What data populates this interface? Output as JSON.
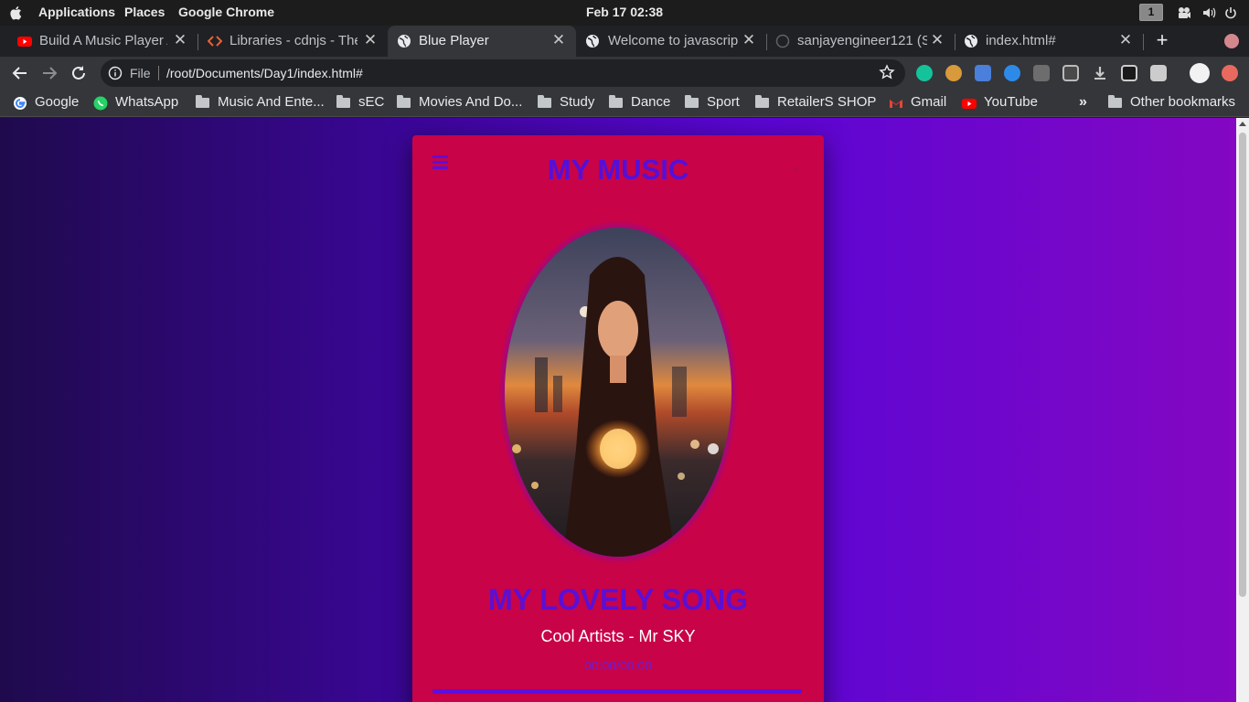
{
  "topbar": {
    "applications": "Applications",
    "places": "Places",
    "app_name": "Google Chrome",
    "clock": "Feb 17  02:38",
    "workspace": "1"
  },
  "tabs": [
    {
      "label": "Build A Music Player A",
      "icon": "youtube-icon"
    },
    {
      "label": "Libraries - cdnjs - The",
      "icon": "cdnjs-icon"
    },
    {
      "label": "Blue Player",
      "icon": "globe-icon",
      "active": true
    },
    {
      "label": "Welcome to javascrip",
      "icon": "globe-icon"
    },
    {
      "label": "sanjayengineer121 (S",
      "icon": "github-icon"
    },
    {
      "label": "index.html#",
      "icon": "globe-icon"
    }
  ],
  "address": {
    "scheme": "File",
    "url": "/root/Documents/Day1/index.html#"
  },
  "bookmarks": [
    {
      "label": "Google",
      "icon": "google-icon"
    },
    {
      "label": "WhatsApp",
      "icon": "whatsapp-icon"
    },
    {
      "label": "Music And Ente...",
      "icon": "folder-icon"
    },
    {
      "label": "sEC",
      "icon": "folder-icon"
    },
    {
      "label": "Movies And Do...",
      "icon": "folder-icon"
    },
    {
      "label": "Study",
      "icon": "folder-icon"
    },
    {
      "label": "Dance",
      "icon": "folder-icon"
    },
    {
      "label": "Sport",
      "icon": "folder-icon"
    },
    {
      "label": "RetailerS SHOP",
      "icon": "folder-icon"
    },
    {
      "label": "Gmail",
      "icon": "gmail-icon"
    },
    {
      "label": "YouTube",
      "icon": "youtube-icon"
    }
  ],
  "bookmarks_overflow": "»",
  "other_bookmarks": "Other bookmarks",
  "player": {
    "brand": "MY MUSIC",
    "song_title": "MY LOVELY SONG",
    "artist": "Cool Artists - Mr SKY",
    "time": "00:00/00:00",
    "progress": 1.0
  },
  "colors": {
    "card": "#c80348",
    "accent": "#5a10d8",
    "gradient_start": "#1f0a4d",
    "gradient_end": "#8407c2"
  }
}
